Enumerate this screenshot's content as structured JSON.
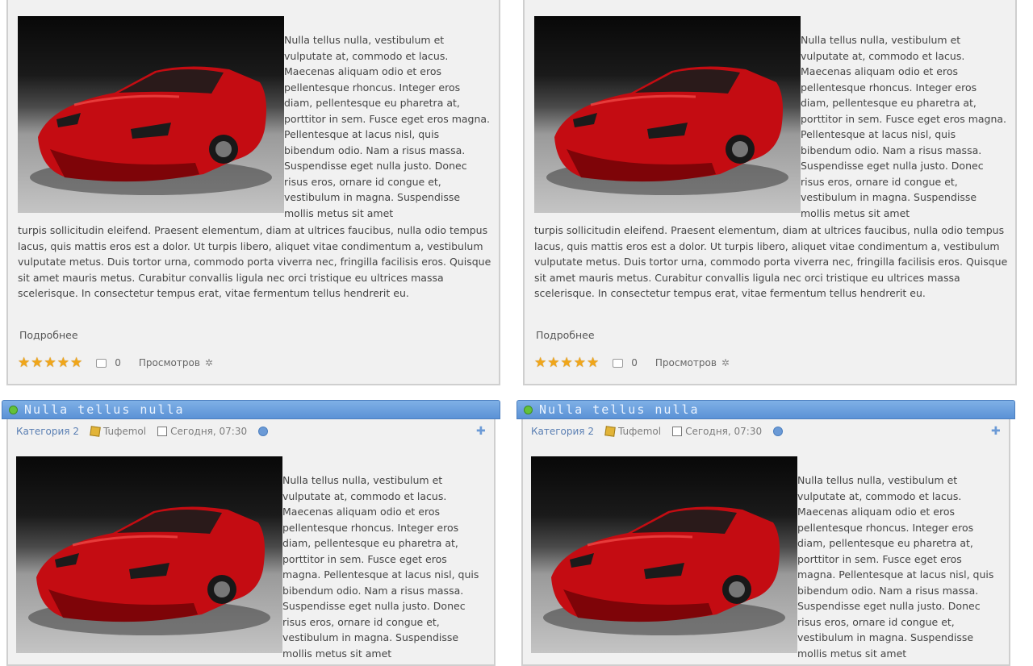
{
  "colors": {
    "accent": "#5b92d6",
    "panel_bg": "#f1f1f1",
    "star": "#f0a61a"
  },
  "article": {
    "title": "Nulla tellus nulla",
    "category": "Категория 2",
    "author": "Tuфemol",
    "date": "Сегодня, 07:30",
    "side_text": "Nulla tellus nulla, vestibulum et vulputate at, commodo et lacus. Maecenas aliquam odio et eros pellentesque rhoncus. Integer eros diam, pellentesque eu pharetra at, porttitor in sem. Fusce eget eros magna. Pellentesque at lacus nisl, quis bibendum odio. Nam a risus massa. Suspendisse eget nulla justo. Donec risus eros, ornare id congue et, vestibulum in magna. Suspendisse mollis metus sit amet",
    "full_text": "turpis sollicitudin eleifend. Praesent elementum, diam at ultrices faucibus, nulla odio tempus lacus, quis mattis eros est a dolor. Ut turpis libero, aliquet vitae condimentum a, vestibulum vulputate metus. Duis tortor urna, commodo porta viverra nec, fringilla facilisis eros. Quisque sit amet mauris metus. Curabitur convallis ligula nec orci tristique eu ultrices massa scelerisque. In consectetur tempus erat, vitae fermentum tellus hendrerit eu.",
    "more_label": "Подробнее",
    "rating": 5,
    "rating_max": 5,
    "comments": "0",
    "views_label": "Просмотров"
  },
  "icons": [
    "green-bullet-icon",
    "pencil-icon",
    "calendar-icon",
    "info-icon",
    "plus-icon",
    "star-icon",
    "comment-icon",
    "views-icon"
  ]
}
